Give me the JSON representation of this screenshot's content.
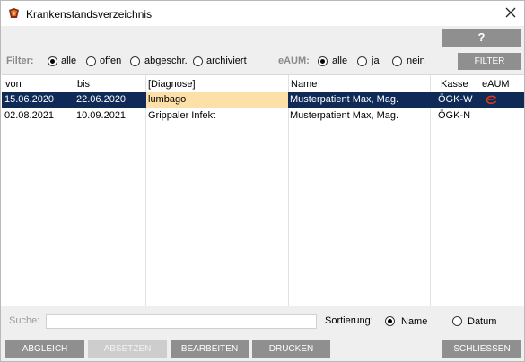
{
  "window": {
    "title": "Krankenstandsverzeichnis"
  },
  "toolbar": {
    "help_label": "?"
  },
  "filter": {
    "label": "Filter:",
    "options": [
      "alle",
      "offen",
      "abgeschr.",
      "archiviert"
    ],
    "selected": "alle",
    "eaum_label": "eAUM:",
    "eaum_options": [
      "alle",
      "ja",
      "nein"
    ],
    "eaum_selected": "alle",
    "button_label": "FILTER"
  },
  "table": {
    "columns": [
      "von",
      "bis",
      "[Diagnose]",
      "Name",
      "Kasse",
      "eAUM"
    ],
    "rows": [
      {
        "von": "15.06.2020",
        "bis": "22.06.2020",
        "diagnose": "lumbago",
        "name": "Musterpatient Max, Mag.",
        "kasse": "ÖGK-W",
        "eaum_icon": "e-aum-icon",
        "selected": true
      },
      {
        "von": "02.08.2021",
        "bis": "10.09.2021",
        "diagnose": "Grippaler Infekt",
        "name": "Musterpatient Max, Mag.",
        "kasse": "ÖGK-N",
        "eaum_icon": "",
        "selected": false
      }
    ]
  },
  "search": {
    "label": "Suche:",
    "value": "",
    "sort_label": "Sortierung:",
    "sort_options": [
      "Name",
      "Datum"
    ],
    "sort_selected": "Name"
  },
  "buttons": {
    "abgleich": "ABGLEICH",
    "absetzen": "ABSETZEN",
    "bearbeiten": "BEARBEITEN",
    "drucken": "DRUCKEN",
    "schliessen": "SCHLIESSEN"
  },
  "colors": {
    "selection": "#0f2a57",
    "highlight_cell": "#fde0a8",
    "button": "#8f8f8f",
    "panel": "#efefef",
    "eaum_icon": "#d9361c"
  }
}
